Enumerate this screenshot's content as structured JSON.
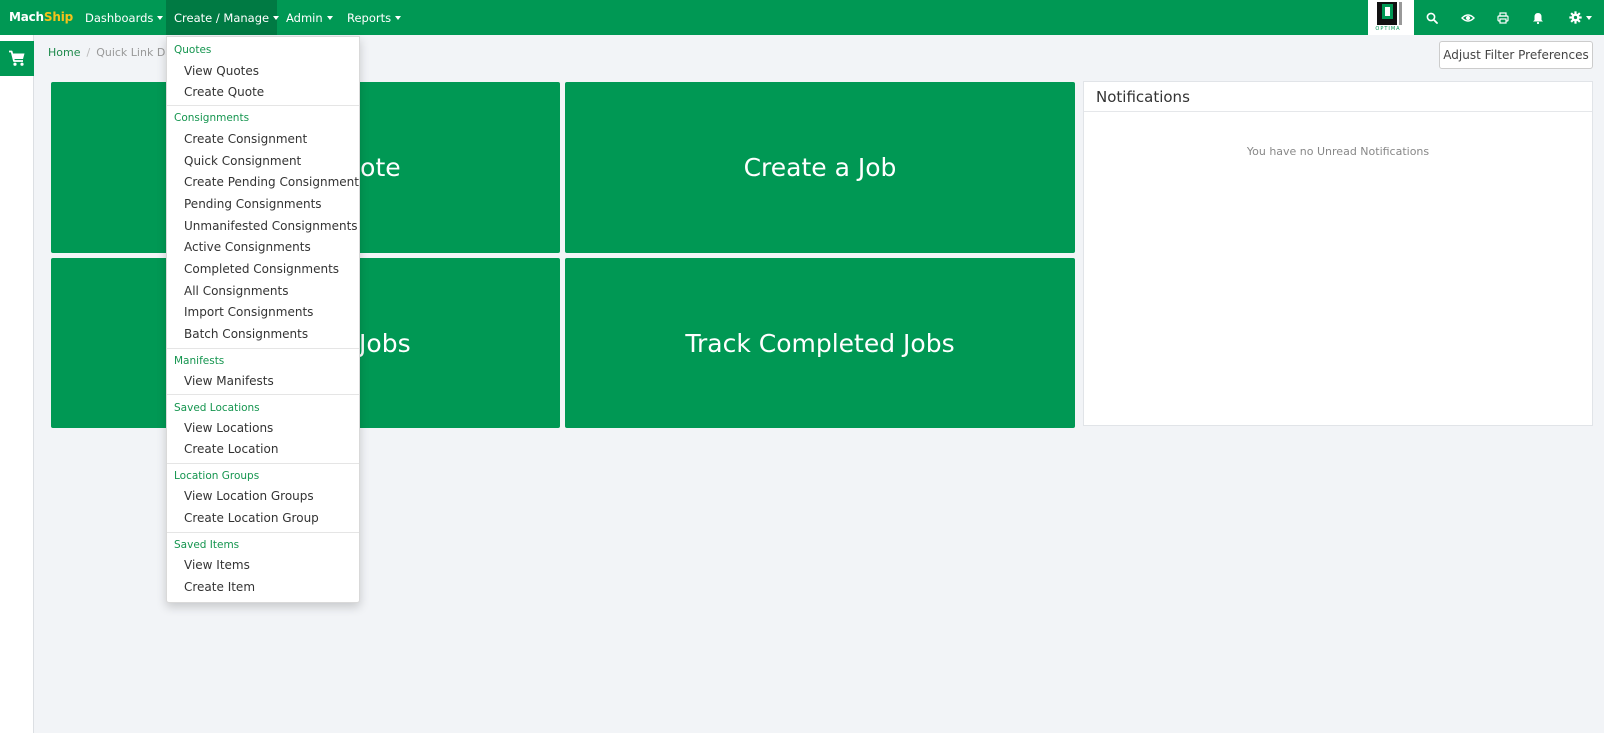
{
  "navbar": {
    "brand_part1": "Mach",
    "brand_part2": "Ship",
    "menus": [
      "Dashboards",
      "Create / Manage",
      "Admin",
      "Reports"
    ],
    "logo_text": "OPTIMA",
    "icons": [
      "search-icon",
      "eye-icon",
      "print-icon",
      "bell-icon",
      "gear-icon"
    ]
  },
  "sidebar": {
    "active_icon": "cart-icon"
  },
  "breadcrumb": {
    "home": "Home",
    "current": "Quick Link Dashboard"
  },
  "toolbar": {
    "adjust_label": "Adjust Filter Preferences"
  },
  "tiles": [
    "Create a Quote",
    "Create a Job",
    "Track Active Jobs",
    "Track Completed Jobs"
  ],
  "notifications": {
    "title": "Notifications",
    "empty_text": "You have no Unread Notifications"
  },
  "dropdown": {
    "groups": [
      {
        "header": "Quotes",
        "items": [
          "View Quotes",
          "Create Quote"
        ]
      },
      {
        "header": "Consignments",
        "items": [
          "Create Consignment",
          "Quick Consignment",
          "Create Pending Consignment",
          "Pending Consignments",
          "Unmanifested Consignments",
          "Active Consignments",
          "Completed Consignments",
          "All Consignments",
          "Import Consignments",
          "Batch Consignments"
        ]
      },
      {
        "header": "Manifests",
        "items": [
          "View Manifests"
        ]
      },
      {
        "header": "Saved Locations",
        "items": [
          "View Locations",
          "Create Location"
        ]
      },
      {
        "header": "Location Groups",
        "items": [
          "View Location Groups",
          "Create Location Group"
        ]
      },
      {
        "header": "Saved Items",
        "items": [
          "View Items",
          "Create Item"
        ]
      }
    ]
  },
  "colors": {
    "brand_green": "#009854",
    "brand_yellow": "#f5c21a",
    "background": "#f2f4f7"
  }
}
